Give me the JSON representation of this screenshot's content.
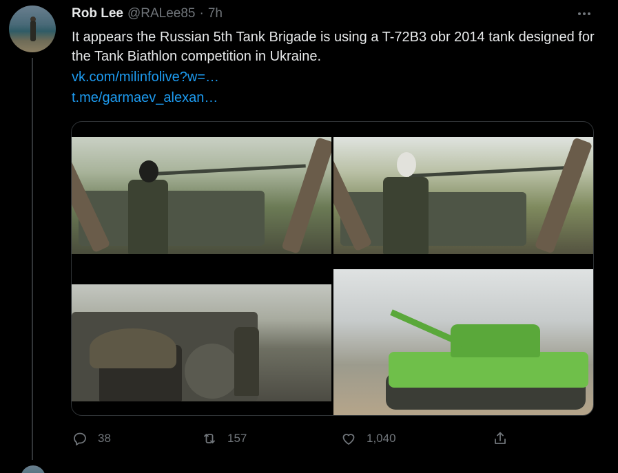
{
  "tweet": {
    "author_name": "Rob Lee",
    "handle": "@RALee85",
    "separator": "·",
    "time": "7h",
    "text": "It appears the Russian 5th Tank Brigade is using a T-72B3 obr 2014 tank designed for the Tank Biathlon competition in Ukraine.",
    "links": [
      "vk.com/milinfolive?w=…",
      "t.me/garmaev_alexan…"
    ]
  },
  "media": [
    {
      "icon": "photo"
    },
    {
      "icon": "photo"
    },
    {
      "icon": "photo"
    },
    {
      "icon": "photo"
    }
  ],
  "actions": {
    "replies": "38",
    "retweets": "157",
    "likes": "1,040"
  },
  "colors": {
    "background": "#000000",
    "text": "#e7e9ea",
    "muted": "#71767b",
    "link": "#1d9bf0",
    "border": "#2f3336"
  }
}
